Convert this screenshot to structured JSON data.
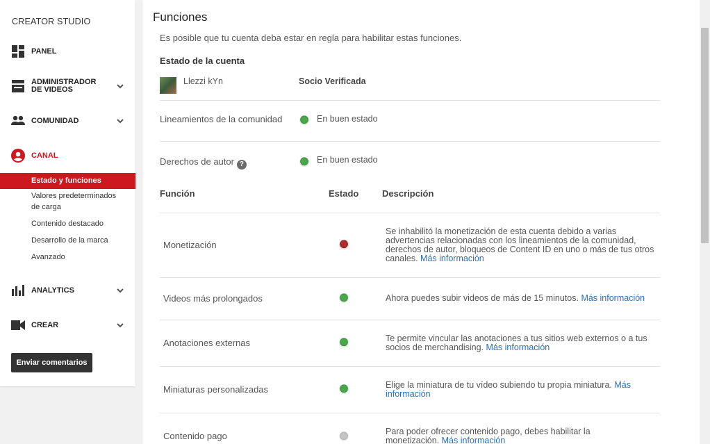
{
  "sidebar": {
    "brand": "CREATOR STUDIO",
    "items": [
      {
        "label": "PANEL",
        "icon": "dashboard-icon"
      },
      {
        "label": "ADMINISTRADOR DE VIDEOS",
        "icon": "video-manager-icon"
      },
      {
        "label": "COMUNIDAD",
        "icon": "people-icon"
      },
      {
        "label": "CANAL",
        "icon": "account-circle-icon"
      },
      {
        "label": "ANALYTICS",
        "icon": "bar-chart-icon"
      },
      {
        "label": "CREAR",
        "icon": "video-camera-icon"
      }
    ],
    "channel_sub": [
      "Estado y funciones",
      "Valores predeterminados de carga",
      "Contenido destacado",
      "Desarrollo de la marca",
      "Avanzado"
    ],
    "feedback_label": "Enviar comentarios",
    "active_color": "#cc181e"
  },
  "main": {
    "title": "Funciones",
    "intro": "Es posible que tu cuenta deba estar en regla para habilitar estas funciones.",
    "account_heading": "Estado de la cuenta",
    "username": "Llezzi kYn",
    "partner_status": "Socio Verificada",
    "community_label": "Lineamientos de la comunidad",
    "community_status": "En buen estado",
    "copyright_label": "Derechos de autor",
    "copyright_status": "En buen estado",
    "headers": {
      "feature": "Función",
      "status": "Estado",
      "description": "Descripción"
    },
    "more_info": "Más información",
    "features": [
      {
        "name": "Monetización",
        "status": "red",
        "desc": "Se inhabilitó la monetización de esta cuenta debido a varias advertencias relacionadas con los lineamientos de la comunidad, derechos de autor, bloqueos de Content ID en uno o más de tus otros canales."
      },
      {
        "name": "Videos más prolongados",
        "status": "green",
        "desc": "Ahora puedes subir videos de más de 15 minutos."
      },
      {
        "name": "Anotaciones externas",
        "status": "green",
        "desc": "Te permite vincular las anotaciones a tus sitios web externos o a tus socios de merchandising."
      },
      {
        "name": "Miniaturas personalizadas",
        "status": "green",
        "desc": "Elige la miniatura de tu vídeo subiendo tu propia miniatura."
      },
      {
        "name": "Contenido pago",
        "status": "grey",
        "desc": "Para poder ofrecer contenido pago, debes habilitar la monetización."
      }
    ]
  }
}
